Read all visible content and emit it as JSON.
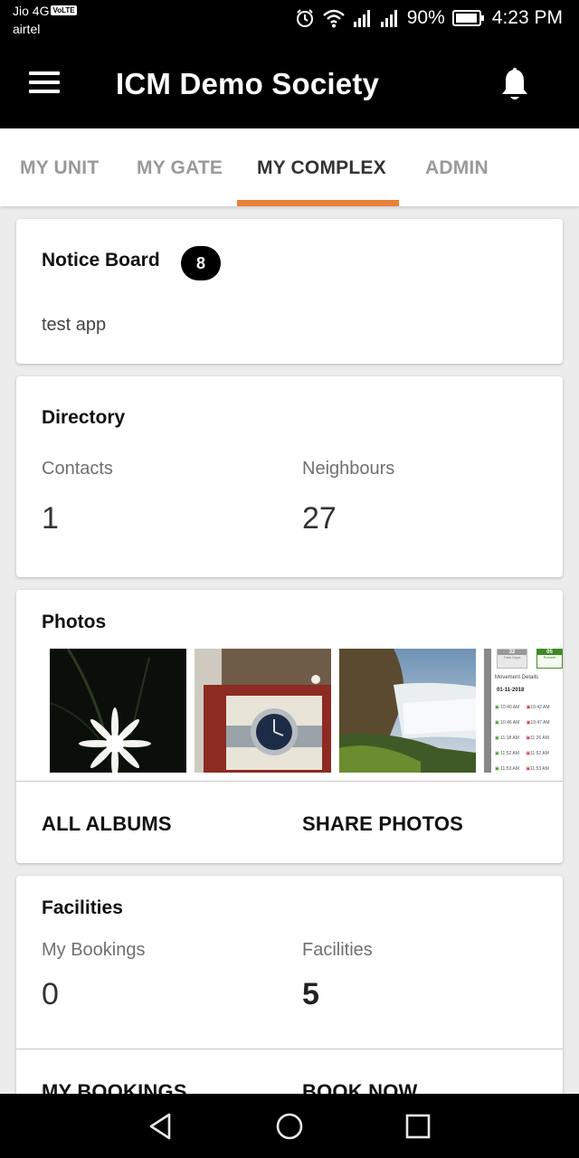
{
  "status_bar": {
    "carrier_primary": "Jio 4G",
    "volte": "VoLTE",
    "carrier_secondary": "airtel",
    "battery": "90%",
    "time": "4:23 PM",
    "icons": [
      "alarm-icon",
      "wifi-icon",
      "signal-icon",
      "battery-icon"
    ]
  },
  "app_bar": {
    "title": "ICM Demo Society",
    "menu_icon": "hamburger-menu-icon",
    "notification_icon": "bell-icon"
  },
  "tabs": [
    {
      "label": "MY UNIT",
      "active": false
    },
    {
      "label": "MY GATE",
      "active": false
    },
    {
      "label": "MY COMPLEX",
      "active": true
    },
    {
      "label": "ADMIN",
      "active": false
    }
  ],
  "accent_color": "#e8813a",
  "notice_board": {
    "title": "Notice Board",
    "count": "8",
    "text": "test app"
  },
  "directory": {
    "title": "Directory",
    "contacts_label": "Contacts",
    "contacts_value": "1",
    "neighbours_label": "Neighbours",
    "neighbours_value": "27"
  },
  "photos": {
    "title": "Photos",
    "all_albums": "ALL ALBUMS",
    "share_photos": "SHARE PHOTOS",
    "thumbnails": [
      "flower-photo",
      "watch-photo",
      "waterfall-photo",
      "attendance-screenshot-photo"
    ],
    "thumb4": {
      "stat1": "32",
      "stat1_label": "Total Days",
      "stat2": "05",
      "stat2_label": "Present",
      "heading": "Movement Details",
      "date": "01-11-2018",
      "rows": [
        {
          "in": "10:40 AM",
          "out": "10:42 AM"
        },
        {
          "in": "10:46 AM",
          "out": "10:47 AM"
        },
        {
          "in": "11:18 AM",
          "out": "11:26 AM"
        },
        {
          "in": "11:52 AM",
          "out": "11:52 AM"
        },
        {
          "in": "11:53 AM",
          "out": "11:53 AM"
        }
      ]
    }
  },
  "facilities": {
    "title": "Facilities",
    "bookings_label": "My Bookings",
    "bookings_value": "0",
    "facilities_label": "Facilities",
    "facilities_value": "5",
    "my_bookings_action": "MY BOOKINGS",
    "book_now_action": "BOOK NOW"
  },
  "nav_bar": {
    "icons": [
      "back-icon",
      "home-icon",
      "recents-icon"
    ]
  }
}
